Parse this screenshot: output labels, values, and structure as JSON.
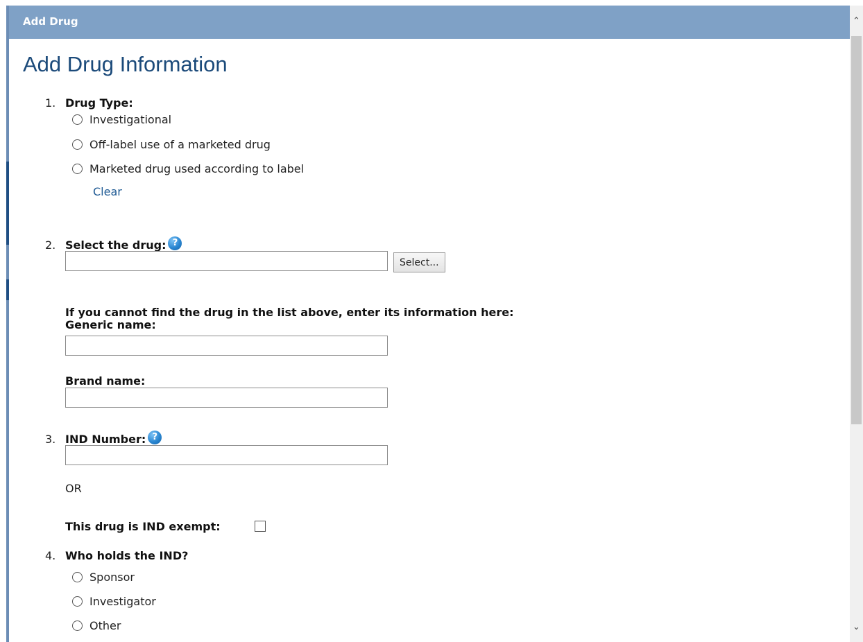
{
  "titlebar": {
    "title": "Add Drug"
  },
  "page": {
    "heading": "Add Drug Information"
  },
  "q1": {
    "number": "1.",
    "label": "Drug Type:",
    "options": [
      "Investigational",
      "Off-label use of a marketed drug",
      "Marketed drug used according to label"
    ],
    "clear_label": "Clear"
  },
  "q2": {
    "number": "2.",
    "label": "Select the drug:",
    "select_button": "Select...",
    "manual_instructions": "If you cannot find the drug in the list above, enter its information here:",
    "generic_label": "Generic name:",
    "brand_label": "Brand name:"
  },
  "q3": {
    "number": "3.",
    "label": "IND Number:",
    "or_text": "OR",
    "exempt_label": "This drug is IND exempt:"
  },
  "q4": {
    "number": "4.",
    "label": "Who holds the IND?",
    "options": [
      "Sponsor",
      "Investigator",
      "Other"
    ]
  },
  "icons": {
    "help": "help-icon",
    "scroll_up": "chevron-up-icon",
    "scroll_down": "chevron-down-icon"
  },
  "colors": {
    "titlebar": "#7fa1c6",
    "heading": "#1b4a7a",
    "link": "#1f5a94"
  }
}
